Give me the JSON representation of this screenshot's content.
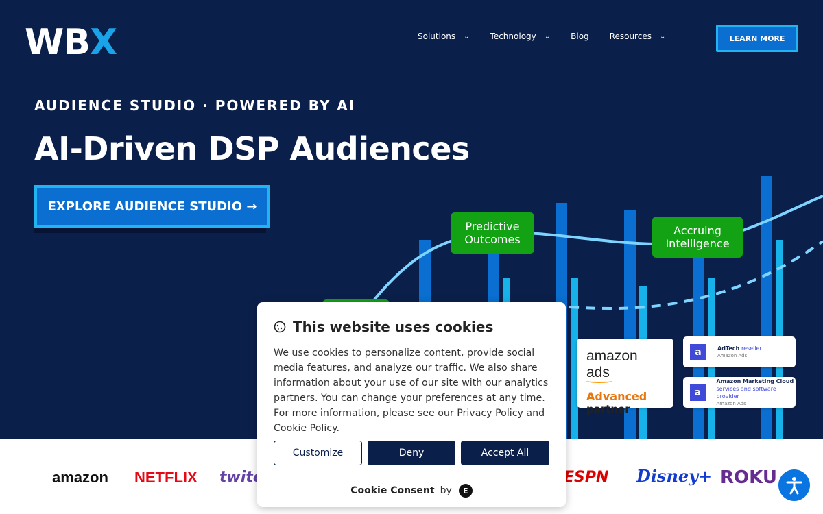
{
  "header": {
    "logo_prefix": "WB",
    "logo_accent": "X",
    "nav": [
      {
        "label": "Solutions",
        "has_dropdown": true
      },
      {
        "label": "Technology",
        "has_dropdown": true
      },
      {
        "label": "Blog",
        "has_dropdown": false
      },
      {
        "label": "Resources",
        "has_dropdown": true
      }
    ],
    "cta_label": "LEARN MORE"
  },
  "hero": {
    "eyebrow": "AUDIENCE STUDIO · POWERED BY AI",
    "headline": "AI-Driven DSP Audiences",
    "cta_label": "EXPLORE AUDIENCE STUDIO →",
    "callouts": [
      {
        "line1": "Predictive",
        "line2": "Outcomes"
      },
      {
        "line1": "Accruing",
        "line2": "Intelligence"
      }
    ],
    "badges": {
      "amazon_ads": {
        "brand": "amazon ads",
        "tier": "Advanced",
        "tier_line2": "partner"
      },
      "adtech": {
        "mark": "a",
        "title_prefix": "AdTech ",
        "title_accent": "reseller",
        "sub": "Amazon Ads"
      },
      "amc": {
        "mark": "a",
        "title": "Amazon Marketing Cloud",
        "subtitle": "services and software provider",
        "sub": "Amazon Ads"
      }
    }
  },
  "client_logos": {
    "amazon": "amazon",
    "netflix": "NETFLIX",
    "twitch": "twitc",
    "espn": "ESPN",
    "disney": "Disney+",
    "roku": "ROKU"
  },
  "cookie_banner": {
    "title": "This website uses cookies",
    "body": "We use cookies to personalize content, provide social media features, and analyze our traffic. We also share information about your use of our site with our analytics partners. You can change your preferences at any time. For more information, please see our Privacy Policy and Cookie Policy.",
    "buttons": {
      "customize": "Customize",
      "deny": "Deny",
      "accept": "Accept All"
    },
    "footer_name": "Cookie Consent",
    "footer_by": "by"
  },
  "colors": {
    "hero_bg": "#0b1f4b",
    "accent_blue": "#1aa3e8",
    "callout_green": "#13a214",
    "button_blue": "#0a6fd0"
  },
  "icons": {
    "accessibility": "accessibility-icon",
    "cookie": "cookie-icon",
    "chevron": "chevron-down-icon"
  }
}
